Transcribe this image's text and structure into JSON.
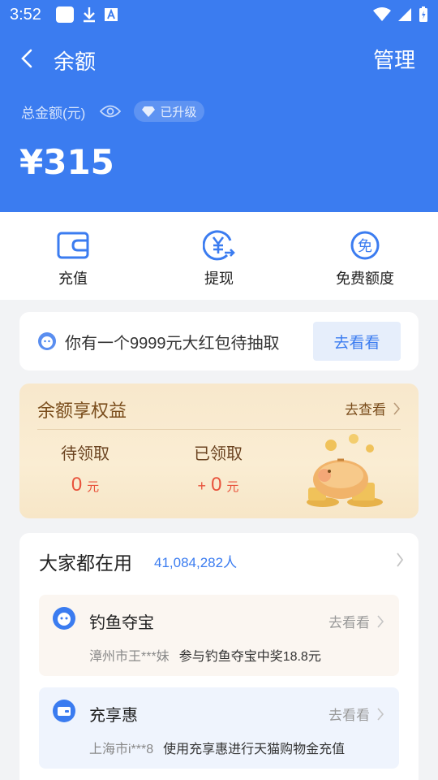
{
  "colors": {
    "primary": "#3b7cf0",
    "benefit_bg": "#f8e8cc",
    "accent_red": "#e8533c",
    "page_bg": "#f2f3f5"
  },
  "status_bar": {
    "time": "3:52"
  },
  "header": {
    "title": "余额",
    "manage": "管理",
    "total_label": "总金额(元)",
    "upgrade_badge": "已升级",
    "balance": "¥315"
  },
  "actions": [
    {
      "label": "充值",
      "icon": "wallet-icon"
    },
    {
      "label": "提现",
      "icon": "yuan-withdraw-icon"
    },
    {
      "label": "免费额度",
      "icon": "free-quota-icon"
    }
  ],
  "packet": {
    "text": "你有一个9999元大红包待抽取",
    "button": "去看看"
  },
  "benefits": {
    "title": "余额享权益",
    "more": "去查看",
    "pending_label": "待领取",
    "pending_value": "0",
    "pending_unit": "元",
    "received_label": "已领取",
    "received_plus": "+",
    "received_value": "0",
    "received_unit": "元"
  },
  "everyone": {
    "title": "大家都在用",
    "count": "41,084,282人",
    "items": [
      {
        "name": "钓鱼夺宝",
        "go": "去看看",
        "who": "漳州市王***妹",
        "what": "参与钓鱼夺宝中奖18.8元",
        "bg": "#fbf6f1"
      },
      {
        "name": "充享惠",
        "go": "去看看",
        "who": "上海市i***8",
        "what": "使用充享惠进行天猫购物金充值",
        "bg": "#eff4fd"
      }
    ]
  }
}
